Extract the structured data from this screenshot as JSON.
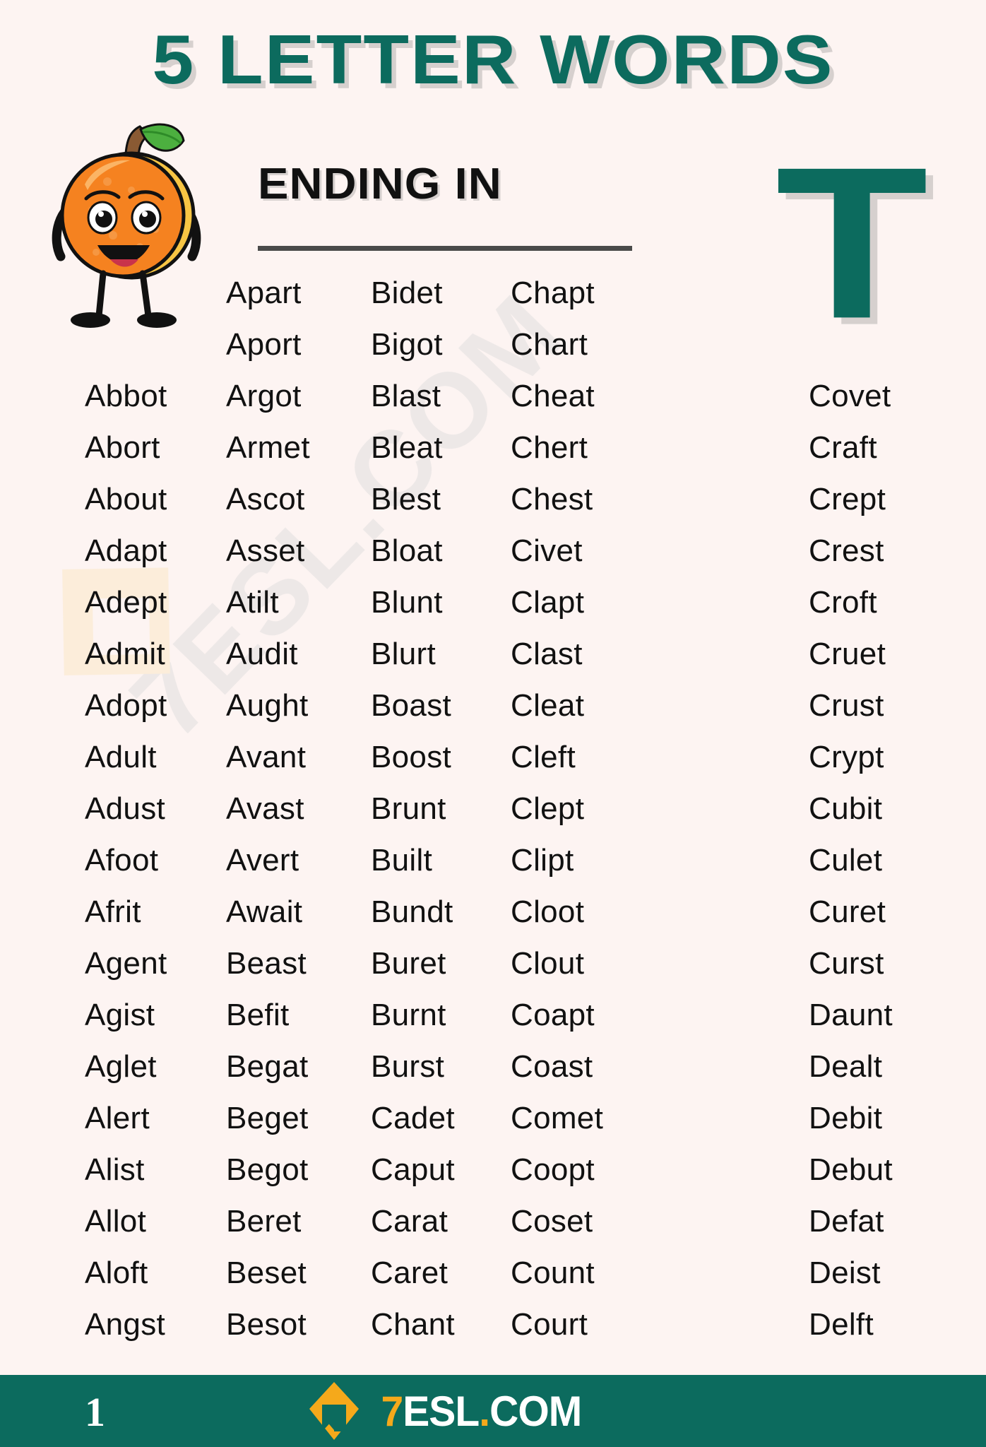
{
  "header": {
    "title": "5 LETTER WORDS",
    "subtitle": "ENDING IN",
    "letter": "T"
  },
  "colors": {
    "brand_teal": "#0C6B5E",
    "background": "#FDF4F2",
    "word_text": "#111111",
    "accent_gold": "#F5A91B",
    "mascot_orange": "#F58220",
    "mascot_leaf": "#4CAF3F"
  },
  "icons": {
    "mascot": "orange-fruit-character-icon",
    "logo": "7esl-diamond-logo-icon"
  },
  "watermark": {
    "text": "7ESL.COM"
  },
  "columns": [
    {
      "id": "col1",
      "lead_spacers": 2,
      "words": [
        "Abbot",
        "Abort",
        "About",
        "Adapt",
        "Adept",
        "Admit",
        "Adopt",
        "Adult",
        "Adust",
        "Afoot",
        "Afrit",
        "Agent",
        "Agist",
        "Aglet",
        "Alert",
        "Alist",
        "Allot",
        "Aloft",
        "Angst"
      ]
    },
    {
      "id": "col2",
      "lead_spacers": 0,
      "words": [
        "Apart",
        "Aport",
        "Argot",
        "Armet",
        "Ascot",
        "Asset",
        "Atilt",
        "Audit",
        "Aught",
        "Avant",
        "Avast",
        "Avert",
        "Await",
        "Beast",
        "Befit",
        "Begat",
        "Beget",
        "Begot",
        "Beret",
        "Beset",
        "Besot"
      ]
    },
    {
      "id": "col3",
      "lead_spacers": 0,
      "words": [
        "Bidet",
        "Bigot",
        "Blast",
        "Bleat",
        "Blest",
        "Bloat",
        "Blunt",
        "Blurt",
        "Boast",
        "Boost",
        "Brunt",
        "Built",
        "Bundt",
        "Buret",
        "Burnt",
        "Burst",
        "Cadet",
        "Caput",
        "Carat",
        "Caret",
        "Chant"
      ]
    },
    {
      "id": "col4",
      "lead_spacers": 0,
      "words": [
        "Chapt",
        "Chart",
        "Cheat",
        "Chert",
        "Chest",
        "Civet",
        "Clapt",
        "Clast",
        "Cleat",
        "Cleft",
        "Clept",
        "Clipt",
        "Cloot",
        "Clout",
        "Coapt",
        "Coast",
        "Comet",
        "Coopt",
        "Coset",
        "Count",
        "Court"
      ]
    },
    {
      "id": "col5",
      "lead_spacers": 2,
      "words": [
        "Covet",
        "Craft",
        "Crept",
        "Crest",
        "Croft",
        "Cruet",
        "Crust",
        "Crypt",
        "Cubit",
        "Culet",
        "Curet",
        "Curst",
        "Daunt",
        "Dealt",
        "Debit",
        "Debut",
        "Defat",
        "Deist",
        "Delft"
      ]
    }
  ],
  "footer": {
    "page_number": "1",
    "brand_part1": "7",
    "brand_part2": "ESL",
    "brand_dot": ".",
    "brand_part3": "COM"
  }
}
